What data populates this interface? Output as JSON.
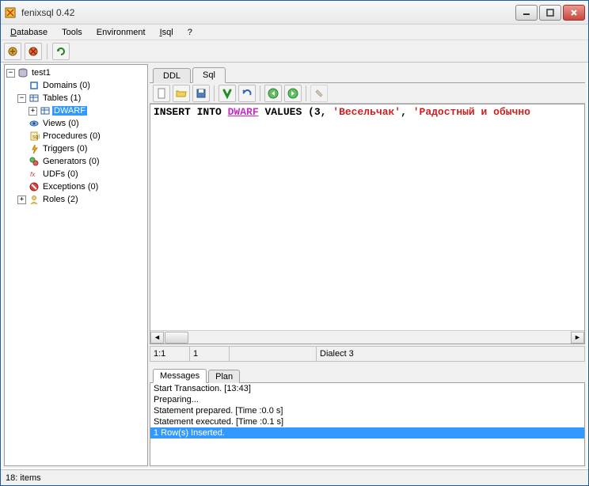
{
  "window": {
    "title": "fenixsql 0.42"
  },
  "menu": {
    "database": "Database",
    "tools": "Tools",
    "environment": "Environment",
    "isql": "Isql",
    "help": "?"
  },
  "tree": {
    "root": "test1",
    "domains": "Domains (0)",
    "tables": "Tables (1)",
    "dwarf": "DWARF",
    "views": "Views (0)",
    "procedures": "Procedures (0)",
    "triggers": "Triggers (0)",
    "generators": "Generators (0)",
    "udfs": "UDFs (0)",
    "exceptions": "Exceptions (0)",
    "roles": "Roles (2)"
  },
  "tabs": {
    "ddl": "DDL",
    "sql": "Sql"
  },
  "sql": {
    "kw1": "INSERT INTO ",
    "ident": "DWARF",
    "kw2": " VALUES ",
    "rest1": "(3, ",
    "str1": "'Весельчак'",
    "rest2": ", ",
    "str2": "'Радостный и обычно"
  },
  "status": {
    "pos": "1:1",
    "col": "1",
    "dialect": "Dialect 3"
  },
  "bottom_tabs": {
    "messages": "Messages",
    "plan": "Plan"
  },
  "messages": {
    "l1": "Start Transaction. [13:43]",
    "l2": "Preparing...",
    "l3": "Statement prepared. [Time :0.0 s]",
    "l4": "Statement executed. [Time :0.1 s]",
    "l5": "1 Row(s) Inserted."
  },
  "statusbar": {
    "text": "18: items"
  }
}
